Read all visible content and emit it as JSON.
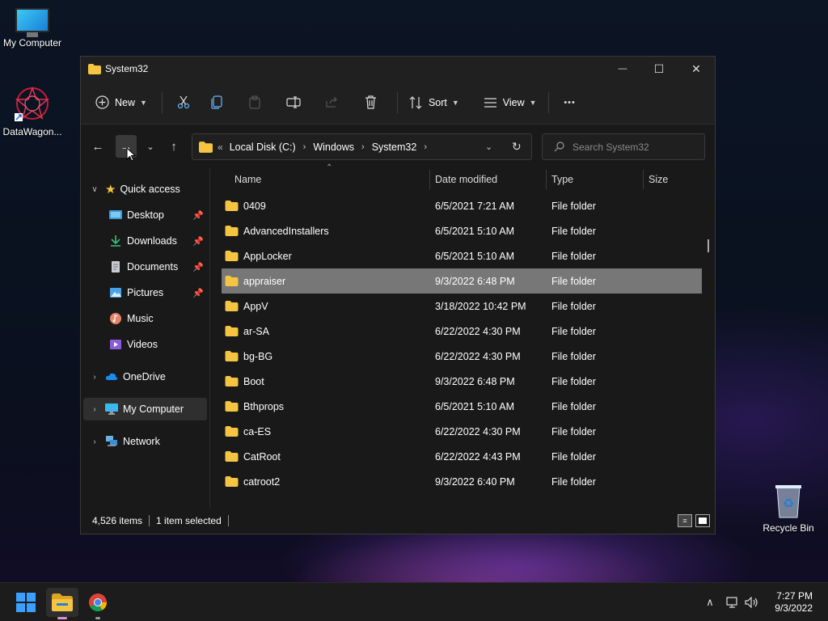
{
  "desktop": {
    "icons": [
      {
        "label": "My Computer"
      },
      {
        "label": "DataWagon..."
      },
      {
        "label": "Recycle Bin"
      }
    ]
  },
  "window": {
    "title": "System32",
    "controls": {
      "minimize": "—",
      "maximize": "☐",
      "close": "✕"
    }
  },
  "toolbar": {
    "new_label": "New",
    "sort_label": "Sort",
    "view_label": "View",
    "more_label": "•••"
  },
  "address": {
    "overflow": "«",
    "crumbs": [
      "Local Disk (C:)",
      "Windows",
      "System32"
    ]
  },
  "search": {
    "placeholder": "Search System32"
  },
  "sidebar": {
    "quick_access": "Quick access",
    "items": [
      {
        "label": "Desktop"
      },
      {
        "label": "Downloads"
      },
      {
        "label": "Documents"
      },
      {
        "label": "Pictures"
      },
      {
        "label": "Music"
      },
      {
        "label": "Videos"
      }
    ],
    "onedrive": "OneDrive",
    "my_computer": "My Computer",
    "network": "Network"
  },
  "columns": {
    "name": "Name",
    "date": "Date modified",
    "type": "Type",
    "size": "Size"
  },
  "files": [
    {
      "name": "0409",
      "date": "6/5/2021 7:21 AM",
      "type": "File folder"
    },
    {
      "name": "AdvancedInstallers",
      "date": "6/5/2021 5:10 AM",
      "type": "File folder"
    },
    {
      "name": "AppLocker",
      "date": "6/5/2021 5:10 AM",
      "type": "File folder"
    },
    {
      "name": "appraiser",
      "date": "9/3/2022 6:48 PM",
      "type": "File folder"
    },
    {
      "name": "AppV",
      "date": "3/18/2022 10:42 PM",
      "type": "File folder"
    },
    {
      "name": "ar-SA",
      "date": "6/22/2022 4:30 PM",
      "type": "File folder"
    },
    {
      "name": "bg-BG",
      "date": "6/22/2022 4:30 PM",
      "type": "File folder"
    },
    {
      "name": "Boot",
      "date": "9/3/2022 6:48 PM",
      "type": "File folder"
    },
    {
      "name": "Bthprops",
      "date": "6/5/2021 5:10 AM",
      "type": "File folder"
    },
    {
      "name": "ca-ES",
      "date": "6/22/2022 4:30 PM",
      "type": "File folder"
    },
    {
      "name": "CatRoot",
      "date": "6/22/2022 4:43 PM",
      "type": "File folder"
    },
    {
      "name": "catroot2",
      "date": "9/3/2022 6:40 PM",
      "type": "File folder"
    }
  ],
  "status": {
    "items": "4,526 items",
    "selected": "1 item selected"
  },
  "taskbar": {
    "time": "7:27 PM",
    "date": "9/3/2022"
  },
  "colors": {
    "folder": "#f5c542",
    "accent": "#3aa0ff",
    "selection": "#777777"
  }
}
